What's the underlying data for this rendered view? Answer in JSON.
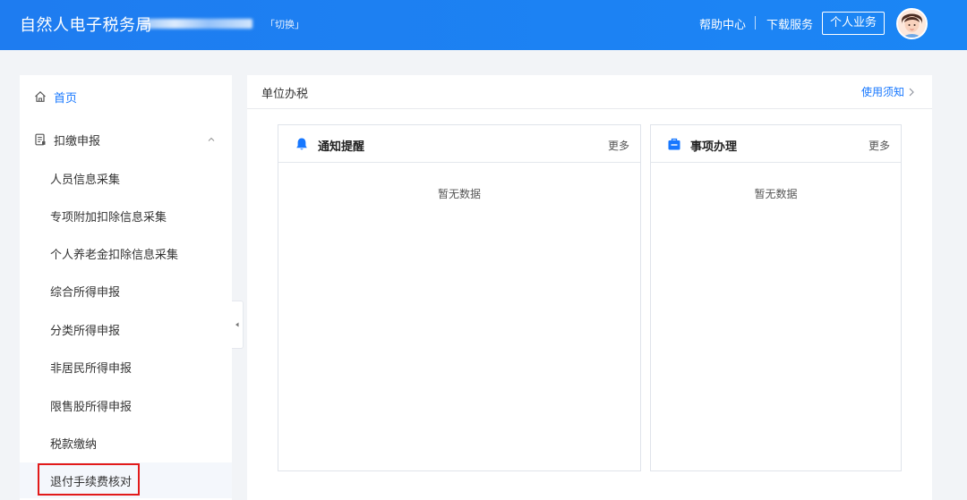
{
  "header": {
    "title": "自然人电子税务局",
    "switch_label": "「切换」",
    "help_label": "帮助中心",
    "download_label": "下载服务",
    "personal_label": "个人业务",
    "colors": {
      "primary": "#1e7cf0"
    }
  },
  "sidebar": {
    "home": {
      "label": "首页",
      "icon": "home-icon"
    },
    "declaration": {
      "label": "扣缴申报",
      "icon": "document-icon",
      "expanded": true
    },
    "items": [
      {
        "label": "人员信息采集"
      },
      {
        "label": "专项附加扣除信息采集"
      },
      {
        "label": "个人养老金扣除信息采集"
      },
      {
        "label": "综合所得申报"
      },
      {
        "label": "分类所得申报"
      },
      {
        "label": "非居民所得申报"
      },
      {
        "label": "限售股所得申报"
      },
      {
        "label": "税款缴纳"
      },
      {
        "label": "退付手续费核对"
      }
    ]
  },
  "main": {
    "title": "单位办税",
    "usage_link": "使用须知",
    "panels": [
      {
        "title": "通知提醒",
        "icon": "bell-icon",
        "more": "更多",
        "empty": "暂无数据"
      },
      {
        "title": "事项办理",
        "icon": "briefcase-icon",
        "more": "更多",
        "empty": "暂无数据"
      }
    ]
  }
}
